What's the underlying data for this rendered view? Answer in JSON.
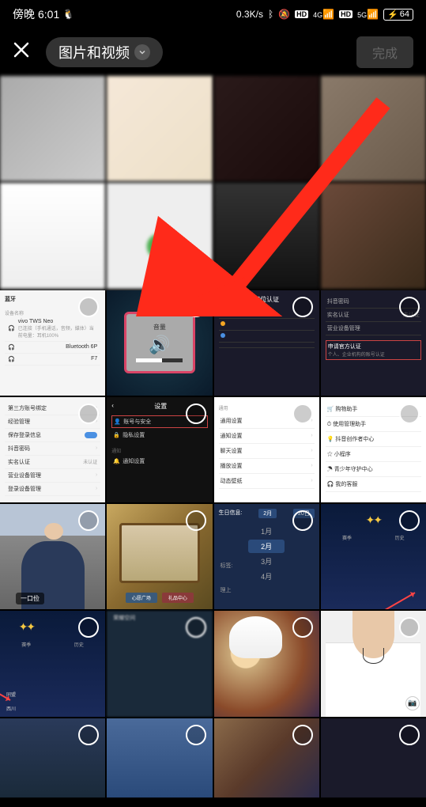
{
  "status_bar": {
    "time_prefix": "傍晚",
    "time": "6:01",
    "network_speed": "0.3K/s",
    "hd_label": "HD",
    "signal_4g": "4G",
    "signal_5g": "5G",
    "battery_pct": "64"
  },
  "header": {
    "dropdown_label": "图片和视频",
    "done_label": "完成"
  },
  "tiles": {
    "row3": {
      "t1": {
        "title": "蓝牙",
        "device_heading": "设备名称",
        "dev1": "vivo TWS Neo",
        "dev1_sub": "已连接（手机通话，音频，媒体）当前电量：耳机100%",
        "dev2": "Bluetooth 6P",
        "dev3": "F7"
      },
      "t2": {
        "volume_label": "音量"
      },
      "t3": {
        "header": "职位认证",
        "line1": "",
        "line2": "",
        "line3": ""
      },
      "t4": {
        "item1": "抖音密码",
        "item2": "实名认证",
        "item2_status": "未认证",
        "item3": "营业设备管理",
        "item4_title": "申请官方认证",
        "item4_sub": "个人、企业机构的账号认证"
      }
    },
    "row4": {
      "t1": {
        "item1": "第三方账号绑定",
        "item2": "经验管理",
        "item3": "保存登录信息",
        "item4": "抖音密码",
        "item5": "实名认证",
        "item5_status": "未认证",
        "item6": "营业设备管理",
        "item7": "登录设备管理"
      },
      "t2": {
        "header": "设置",
        "item1": "账号与安全",
        "item2": "隐私设置",
        "section": "通知",
        "item3": "通知设置"
      },
      "t3": {
        "section": "通用",
        "item1": "通用设置",
        "item2": "通知设置",
        "item3": "聊天设置",
        "item4": "播放设置",
        "item5": "动态壁纸"
      },
      "t4": {
        "item1": "购物助手",
        "item2": "使用管理助手",
        "item3": "抖音创作者中心",
        "item4": "小程序",
        "item5": "青少年守护中心",
        "item6": "我的客服"
      }
    },
    "row5": {
      "t1": {
        "person_label": "一口俭"
      },
      "t2": {
        "btn1": "心愿广场",
        "btn2": "礼品中心"
      },
      "t3": {
        "header_left": "生日信息:",
        "header_mid": "2月",
        "header_right": "20日",
        "month1": "1月",
        "month2": "2月",
        "month3": "3月",
        "month4": "4月",
        "label_tag": "标签:",
        "label_prov": "理上"
      },
      "t4": {
        "tab1": "赛季",
        "tab2": "历史"
      }
    },
    "row6": {
      "t1": {
        "tab1": "赛季",
        "tab2": "历史",
        "txt1": "同盟",
        "txt2": "西川"
      },
      "t2": {
        "top_label": "荣耀空间"
      }
    }
  }
}
